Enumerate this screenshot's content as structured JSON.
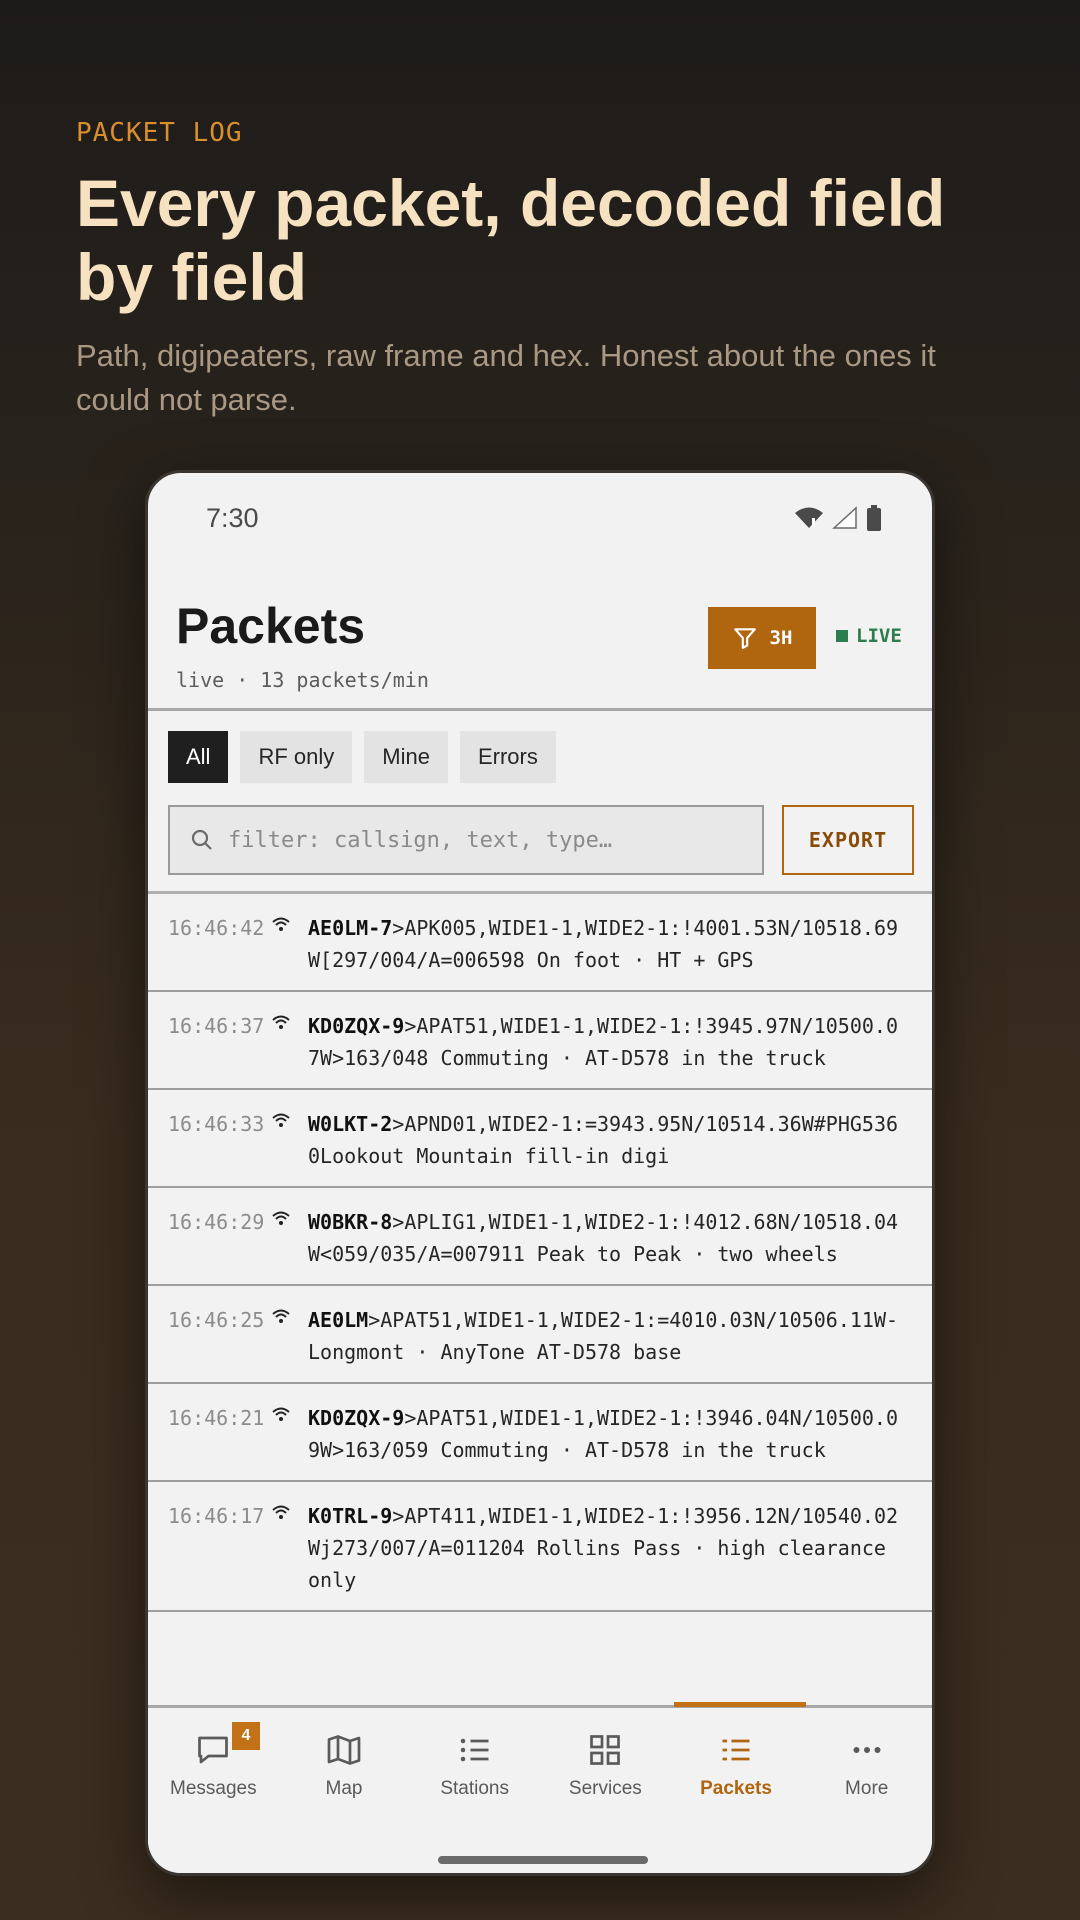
{
  "hero": {
    "eyebrow": "PACKET LOG",
    "headline": "Every packet, decoded field by field",
    "subhead": "Path, digipeaters, raw frame and hex. Honest about the ones it could not parse."
  },
  "status": {
    "time": "7:30"
  },
  "header": {
    "title": "Packets",
    "subtitle": "live · 13 packets/min",
    "filter_label": "3H",
    "live_label": "LIVE"
  },
  "chips": [
    "All",
    "RF only",
    "Mine",
    "Errors"
  ],
  "search": {
    "placeholder": "filter: callsign, text, type…",
    "value": ""
  },
  "export_label": "EXPORT",
  "packets": [
    {
      "time": "16:46:42",
      "callsign": "AE0LM-7",
      "payload": ">APK005,WIDE1-1,WIDE2-1:!4001.53N/10518.69W[297/004/A=006598 On foot · HT + GPS"
    },
    {
      "time": "16:46:37",
      "callsign": "KD0ZQX-9",
      "payload": ">APAT51,WIDE1-1,WIDE2-1:!3945.97N/10500.07W>163/048 Commuting · AT-D578 in the truck"
    },
    {
      "time": "16:46:33",
      "callsign": "W0LKT-2",
      "payload": ">APND01,WIDE2-1:=3943.95N/10514.36W#PHG5360Lookout Mountain fill-in digi"
    },
    {
      "time": "16:46:29",
      "callsign": "W0BKR-8",
      "payload": ">APLIG1,WIDE1-1,WIDE2-1:!4012.68N/10518.04W<059/035/A=007911 Peak to Peak · two wheels"
    },
    {
      "time": "16:46:25",
      "callsign": "AE0LM",
      "payload": ">APAT51,WIDE1-1,WIDE2-1:=4010.03N/10506.11W-Longmont · AnyTone AT-D578 base"
    },
    {
      "time": "16:46:21",
      "callsign": "KD0ZQX-9",
      "payload": ">APAT51,WIDE1-1,WIDE2-1:!3946.04N/10500.09W>163/059 Commuting · AT-D578 in the truck"
    },
    {
      "time": "16:46:17",
      "callsign": "K0TRL-9",
      "payload": ">APT411,WIDE1-1,WIDE2-1:!3956.12N/10540.02Wj273/007/A=011204 Rollins Pass · high clearance only"
    }
  ],
  "tabs": [
    {
      "label": "Messages",
      "badge": "4"
    },
    {
      "label": "Map"
    },
    {
      "label": "Stations"
    },
    {
      "label": "Services"
    },
    {
      "label": "Packets"
    },
    {
      "label": "More"
    }
  ],
  "colors": {
    "accent": "#b0650f",
    "live": "#2e7d4f",
    "headline": "#f6e1c0"
  }
}
